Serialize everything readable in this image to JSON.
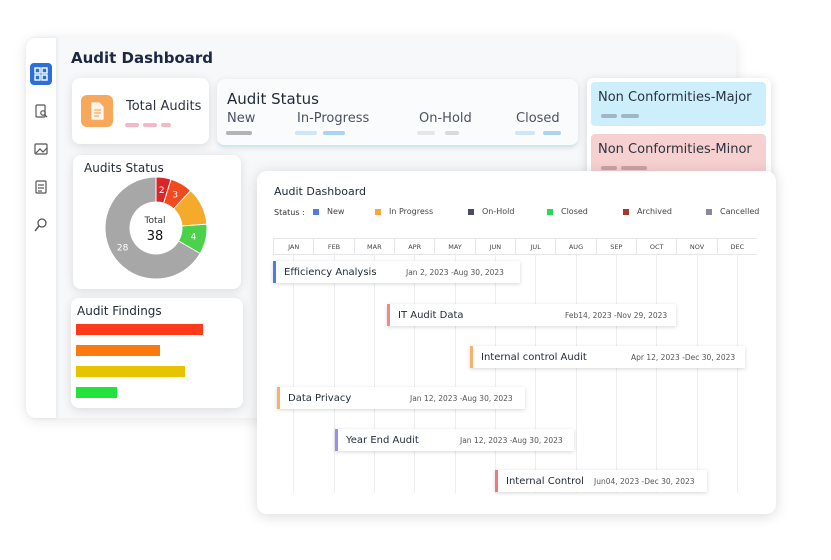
{
  "app": {
    "title": "Audit Dashboard"
  },
  "sidebar": {
    "items": [
      {
        "icon": "dashboard-grid-icon"
      },
      {
        "icon": "clipboard-search-icon"
      },
      {
        "icon": "image-report-icon"
      },
      {
        "icon": "checklist-icon"
      },
      {
        "icon": "magnifier-icon"
      }
    ]
  },
  "total_audits": {
    "label": "Total Audits",
    "icon": "document-icon"
  },
  "audit_status": {
    "title": "Audit Status",
    "labels": [
      "New",
      "In-Progress",
      "On-Hold",
      "Closed"
    ]
  },
  "non_conformities": {
    "major": "Non Conformities-Major",
    "minor": "Non Conformities-Minor"
  },
  "audits_status_card": {
    "title": "Audits Status",
    "center_label": "Total",
    "center_value": "38"
  },
  "chart_data": {
    "type": "pie",
    "title": "Audits Status",
    "slices": [
      {
        "value": 2,
        "label": "2",
        "color": "#d9262b"
      },
      {
        "value": 3,
        "label": "3",
        "color": "#f04a1e"
      },
      {
        "value": 5,
        "label": "",
        "color": "#f5aa2b"
      },
      {
        "value": 4,
        "label": "4",
        "color": "#4bd14a"
      },
      {
        "value": 28,
        "label": "28",
        "color": "#a7a7a7"
      }
    ]
  },
  "audit_findings": {
    "title": "Audit Findings",
    "bars": [
      {
        "value": 1.0,
        "color": "#fe3a1a"
      },
      {
        "value": 0.66,
        "color": "#fb7a10"
      },
      {
        "value": 0.86,
        "color": "#e6c400"
      },
      {
        "value": 0.32,
        "color": "#22e33c"
      }
    ]
  },
  "gantt": {
    "title": "Audit Dashboard",
    "status_prefix": "Status :",
    "legend": [
      {
        "label": "New",
        "color": "#4e7ce0"
      },
      {
        "label": "In Progress",
        "color": "#f5a93a"
      },
      {
        "label": "On-Hold",
        "color": "#4a4a6a"
      },
      {
        "label": "Closed",
        "color": "#22dd55"
      },
      {
        "label": "Archived",
        "color": "#a33a2a"
      },
      {
        "label": "Cancelled",
        "color": "#8888a0"
      }
    ],
    "months": [
      "JAN",
      "FEB",
      "MAR",
      "APR",
      "MAY",
      "JUN",
      "JUL",
      "AUG",
      "SEP",
      "OCT",
      "NOV",
      "DEC"
    ],
    "tasks": [
      {
        "name": "Efficiency Analysis",
        "dates": "Jan 2, 2023 -Aug 30, 2023",
        "color": "#4e7ce0"
      },
      {
        "name": "IT Audit Data",
        "dates": "Feb14, 2023 -Nov 29, 2023",
        "color": "#f08a8a"
      },
      {
        "name": "Internal control Audit",
        "dates": "Apr 12, 2023 -Dec 30, 2023",
        "color": "#f5b26b"
      },
      {
        "name": "Data Privacy",
        "dates": "Jan 12, 2023 -Aug 30, 2023",
        "color": "#f5b26b"
      },
      {
        "name": "Year End Audit",
        "dates": "Jan 12, 2023 -Aug 30, 2023",
        "color": "#9a8cf0"
      },
      {
        "name": "Internal Control",
        "dates": "Jun04, 2023 -Dec 30, 2023",
        "color": "#f07a7a"
      }
    ]
  }
}
